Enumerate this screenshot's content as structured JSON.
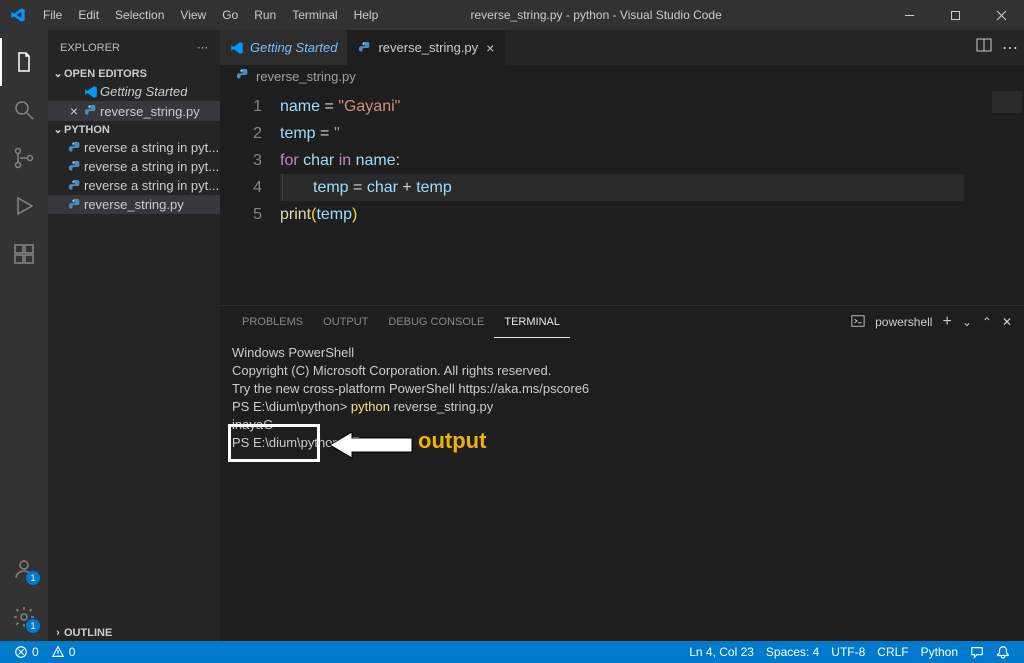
{
  "title": "reverse_string.py - python - Visual Studio Code",
  "menu": [
    "File",
    "Edit",
    "Selection",
    "View",
    "Go",
    "Run",
    "Terminal",
    "Help"
  ],
  "sidebar": {
    "title": "EXPLORER",
    "sections": {
      "open_editors": {
        "label": "OPEN EDITORS",
        "items": [
          {
            "label": "Getting Started",
            "icon": "vscode",
            "italic": true
          },
          {
            "label": "reverse_string.py",
            "icon": "python",
            "active": true,
            "showClose": true
          }
        ]
      },
      "workspace": {
        "label": "PYTHON",
        "items": [
          {
            "label": "reverse a string in pyt...",
            "icon": "python"
          },
          {
            "label": "reverse a string in pyt...",
            "icon": "python"
          },
          {
            "label": "reverse a string in pyt...",
            "icon": "python"
          },
          {
            "label": "reverse_string.py",
            "icon": "python",
            "active": true
          }
        ]
      },
      "outline": {
        "label": "OUTLINE"
      }
    }
  },
  "tabs": [
    {
      "label": "Getting Started",
      "icon": "vscode",
      "active": false,
      "cls": "getting"
    },
    {
      "label": "reverse_string.py",
      "icon": "python",
      "active": true,
      "cls": ""
    }
  ],
  "breadcrumb": {
    "file": "reverse_string.py"
  },
  "code": {
    "lines": [
      [
        {
          "t": "name",
          "c": "var"
        },
        {
          "t": " ",
          "c": "op"
        },
        {
          "t": "=",
          "c": "op"
        },
        {
          "t": " ",
          "c": "op"
        },
        {
          "t": "\"Gayani\"",
          "c": "str"
        }
      ],
      [
        {
          "t": "temp",
          "c": "var"
        },
        {
          "t": " ",
          "c": "op"
        },
        {
          "t": "=",
          "c": "op"
        },
        {
          "t": " ",
          "c": "op"
        },
        {
          "t": "''",
          "c": "str"
        }
      ],
      [
        {
          "t": "for",
          "c": "kw"
        },
        {
          "t": " ",
          "c": "op"
        },
        {
          "t": "char",
          "c": "var"
        },
        {
          "t": " ",
          "c": "op"
        },
        {
          "t": "in",
          "c": "kw"
        },
        {
          "t": " ",
          "c": "op"
        },
        {
          "t": "name",
          "c": "var"
        },
        {
          "t": ":",
          "c": "op"
        }
      ],
      [
        {
          "t": "temp",
          "c": "var"
        },
        {
          "t": " ",
          "c": "op"
        },
        {
          "t": "=",
          "c": "op"
        },
        {
          "t": " ",
          "c": "op"
        },
        {
          "t": "char",
          "c": "var"
        },
        {
          "t": " ",
          "c": "op"
        },
        {
          "t": "+",
          "c": "op"
        },
        {
          "t": " ",
          "c": "op"
        },
        {
          "t": "temp",
          "c": "var"
        }
      ],
      [
        {
          "t": "print",
          "c": "fn"
        },
        {
          "t": "(",
          "c": "br"
        },
        {
          "t": "temp",
          "c": "var"
        },
        {
          "t": ")",
          "c": "br"
        }
      ]
    ],
    "highlight_line": 4,
    "indent_lines": [
      4
    ]
  },
  "panel": {
    "tabs": [
      "PROBLEMS",
      "OUTPUT",
      "DEBUG CONSOLE",
      "TERMINAL"
    ],
    "active_tab": 3,
    "shell_label": "powershell",
    "terminal_lines": [
      "Windows PowerShell",
      "Copyright (C) Microsoft Corporation. All rights reserved.",
      "",
      "Try the new cross-platform PowerShell https://aka.ms/pscore6",
      ""
    ],
    "prompt1_path": "dium\\python",
    "prompt1_cmd": "python",
    "prompt1_arg": "reverse_string.py",
    "output_value": "inayaG",
    "prompt2_path": "dium\\python"
  },
  "annotation": {
    "label": "output"
  },
  "status": {
    "errors": "0",
    "warnings": "0",
    "cursor": "Ln 4, Col 23",
    "spaces": "Spaces: 4",
    "encoding": "UTF-8",
    "eol": "CRLF",
    "lang": "Python"
  },
  "badges": {
    "account": "1",
    "settings": "1"
  }
}
